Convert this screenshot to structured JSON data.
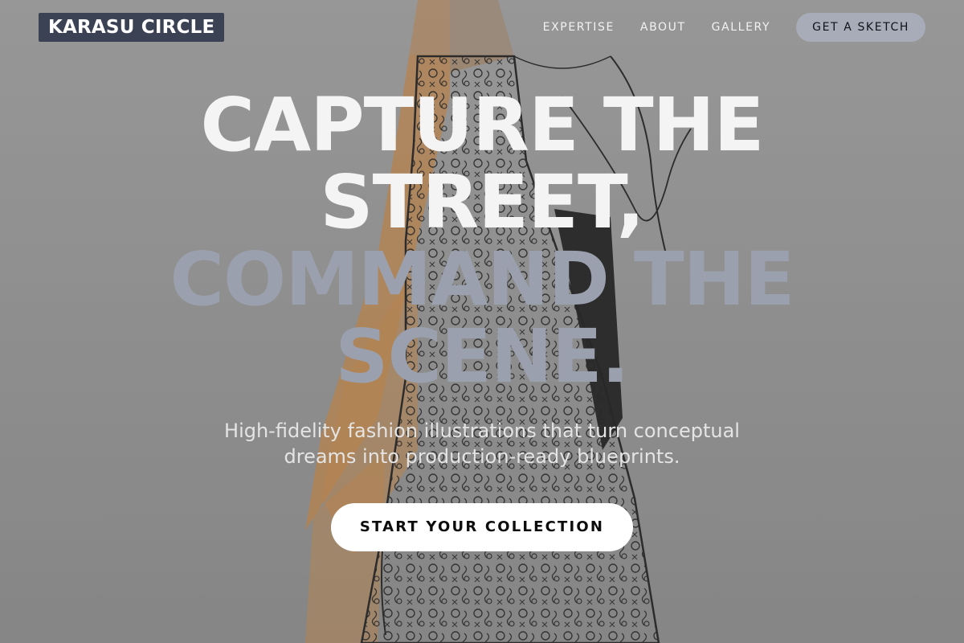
{
  "header": {
    "logo_text": "KARASU CIRCLE",
    "nav": [
      {
        "label": "EXPERTISE"
      },
      {
        "label": "ABOUT"
      },
      {
        "label": "GALLERY"
      }
    ],
    "cta_label": "GET A SKETCH"
  },
  "hero": {
    "headline_lines": [
      "CAPTURE THE",
      "STREET,",
      "COMMAND THE",
      "SCENE."
    ],
    "subtitle_lines": [
      "High-fidelity fashion illustrations that turn conceptual",
      "dreams into production-ready blueprints."
    ],
    "cta_label": "START YOUR COLLECTION",
    "background_description_icon": "fashion-sketch-illustration"
  },
  "colors": {
    "logo_bg": "#3b4254",
    "headline_light": "#f4f4f4",
    "headline_muted": "#9aa0ad",
    "nav_cta_bg": "#a7acb8",
    "cta_bg": "#ffffff",
    "watercolor_accent": "#c98a4a"
  }
}
